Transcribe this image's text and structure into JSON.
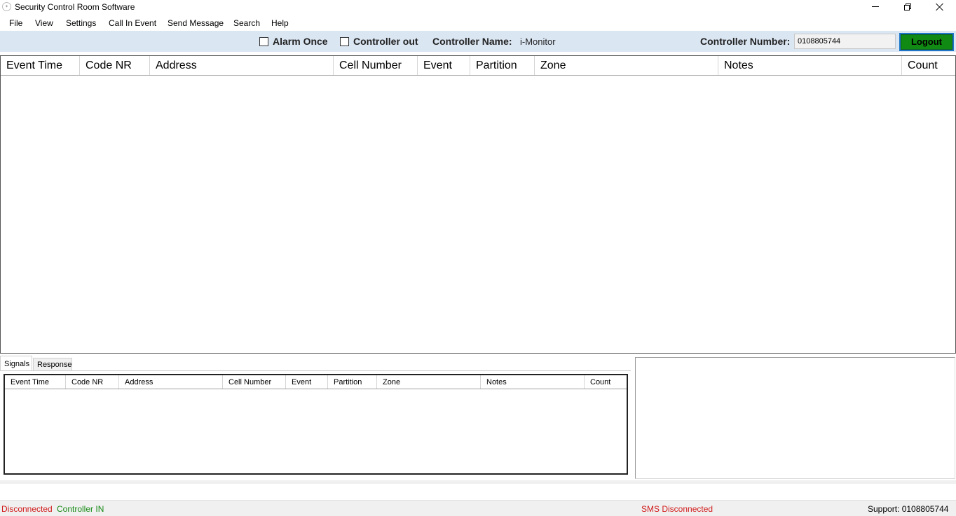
{
  "window": {
    "title": "Security Control Room Software",
    "icon": "app-logo-icon"
  },
  "menu": [
    "File",
    "View",
    "Settings",
    "Call In Event",
    "Send Message",
    "Search",
    "Help"
  ],
  "toolbar": {
    "alarm_once_label": "Alarm Once",
    "alarm_once_checked": false,
    "controller_out_label": "Controller out",
    "controller_out_checked": false,
    "controller_name_label": "Controller Name:",
    "controller_name_value": "i-Monitor",
    "controller_number_label": "Controller Number:",
    "controller_number_value": "0108805744",
    "logout_label": "Logout",
    "logout_color": "#108a12"
  },
  "main_grid": {
    "columns": [
      "Event Time",
      "Code NR",
      "Address",
      "Cell Number",
      "Event",
      "Partition",
      "Zone",
      "Notes",
      "Count"
    ],
    "rows": []
  },
  "tabs": [
    "Signals",
    "Response"
  ],
  "signals_grid": {
    "columns": [
      "Event Time",
      "Code NR",
      "Address",
      "Cell Number",
      "Event",
      "Partition",
      "Zone",
      "Notes",
      "Count"
    ],
    "rows": []
  },
  "status": {
    "connection": "Disconnected",
    "controller": "Controller IN",
    "sms": "SMS Disconnected",
    "support": "Support: 0108805744",
    "error_color": "#d11a1a",
    "ok_color": "#198c19"
  }
}
